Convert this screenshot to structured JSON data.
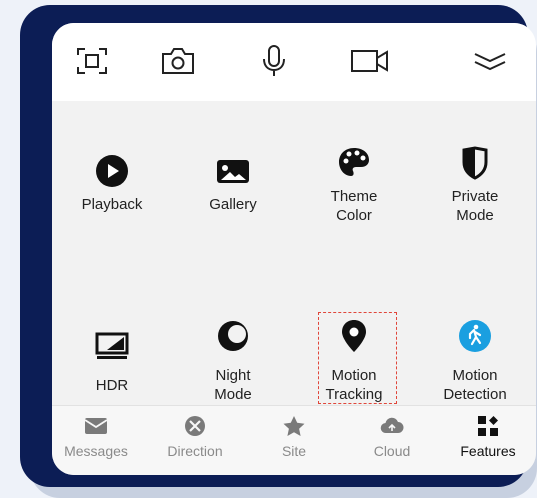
{
  "toolbar": {
    "buttons": [
      {
        "icon": "screenshot-icon"
      },
      {
        "icon": "camera-icon"
      },
      {
        "icon": "microphone-icon"
      },
      {
        "icon": "video-icon"
      },
      {
        "icon": "collapse-chevron-icon"
      }
    ]
  },
  "features": [
    {
      "label": "Playback",
      "icon": "play-circle-icon"
    },
    {
      "label": "Gallery",
      "icon": "image-icon"
    },
    {
      "label": "Theme\nColor",
      "icon": "palette-icon"
    },
    {
      "label": "Private\nMode",
      "icon": "half-shield-icon"
    },
    {
      "label": "HDR",
      "icon": "hdr-icon"
    },
    {
      "label": "Night\nMode",
      "icon": "moon-icon"
    },
    {
      "label": "Motion\nTracking",
      "icon": "location-pin-icon"
    },
    {
      "label": "Motion\nDetection",
      "icon": "walking-person-icon",
      "accent": "#1a9fe0"
    }
  ],
  "bottom_nav": {
    "items": [
      {
        "label": "Messages",
        "icon": "envelope-icon"
      },
      {
        "label": "Direction",
        "icon": "compass-icon"
      },
      {
        "label": "Site",
        "icon": "star-icon"
      },
      {
        "label": "Cloud",
        "icon": "cloud-icon"
      },
      {
        "label": "Features",
        "icon": "grid-icon",
        "active": true
      }
    ]
  },
  "colors": {
    "device_frame": "#0c1d55",
    "highlight_border": "#e0463a",
    "accent_blue": "#1a9fe0"
  }
}
